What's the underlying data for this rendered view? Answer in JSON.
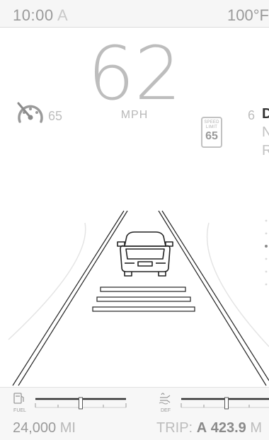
{
  "status_bar": {
    "time": "10:00",
    "ampm": "A",
    "temperature": "100°F"
  },
  "speedometer": {
    "speed": "62",
    "unit": "MPH"
  },
  "cruise_control": {
    "icon": "cruise-control-icon",
    "set_speed": "65"
  },
  "speed_limit_sign": {
    "label_line1": "SPEED",
    "label_line2": "LIMIT",
    "value": "65"
  },
  "gear": {
    "number": "6",
    "letters": [
      "D",
      "N",
      "R"
    ],
    "active": "D"
  },
  "gauges": {
    "fuel": {
      "label": "FUEL",
      "icon": "fuel-pump-icon",
      "level": 0.5
    },
    "def": {
      "label": "DEF",
      "icon": "def-fluid-icon",
      "level": 0.5
    }
  },
  "odometer": {
    "value": "24,000",
    "unit": "MI"
  },
  "trip": {
    "label": "TRIP:",
    "name": "A",
    "value": "423.9",
    "unit": "M"
  },
  "colors": {
    "background": "#ffffff",
    "text_muted": "#bdbdbd",
    "text_dark": "#8a8a8a",
    "lane_line": "#222222"
  }
}
